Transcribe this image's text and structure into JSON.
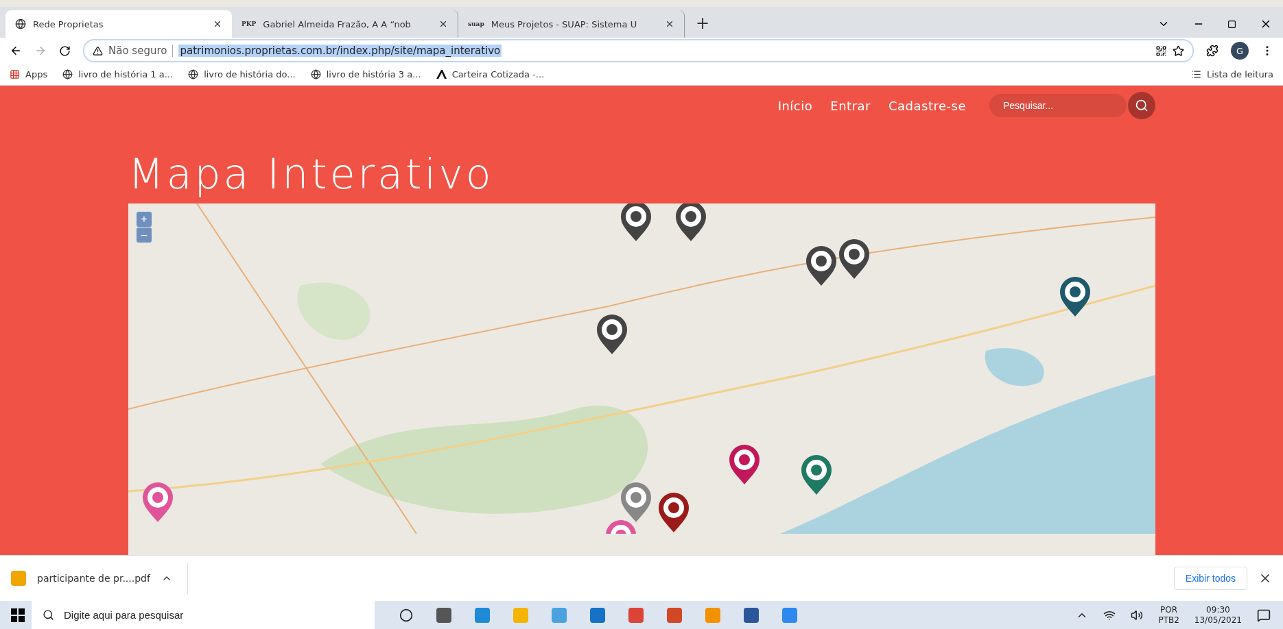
{
  "browser": {
    "tabs": [
      {
        "kind": "globe",
        "label": "Rede Proprietas",
        "selected": true
      },
      {
        "kind": "text",
        "favicon": "PKP",
        "label": "Gabriel Almeida Frazão, A A “nob",
        "selected": false
      },
      {
        "kind": "text",
        "favicon": "suap",
        "label": "Meus Projetos - SUAP: Sistema U",
        "selected": false
      }
    ],
    "new_tab": "+",
    "address": {
      "warning": "Não seguro",
      "url": "patrimonios.proprietas.com.br/index.php/site/mapa_interativo"
    },
    "profile": "G",
    "bookmarks": [
      {
        "kind": "apps",
        "label": "Apps"
      },
      {
        "kind": "globe",
        "label": "livro de história 1 a..."
      },
      {
        "kind": "globe",
        "label": "livro de história do..."
      },
      {
        "kind": "globe",
        "label": "livro de história 3 a..."
      },
      {
        "kind": "logo",
        "label": "Carteira Cotizada -..."
      }
    ],
    "reading_list": "Lista de leitura"
  },
  "page": {
    "nav": [
      "Início",
      "Entrar",
      "Cadastre-se"
    ],
    "search": {
      "placeholder": "Pesquisar..."
    },
    "title": "Mapa Interativo",
    "zoom": [
      "+",
      "–"
    ]
  },
  "downloads": {
    "file": "participante de pr....pdf",
    "show_all": "Exibir todos"
  },
  "taskbar": {
    "search": {
      "placeholder": "Digite aqui para pesquisar"
    },
    "lang": [
      "POR",
      "PTB2"
    ],
    "time": "09:30",
    "date": "13/05/2021"
  }
}
